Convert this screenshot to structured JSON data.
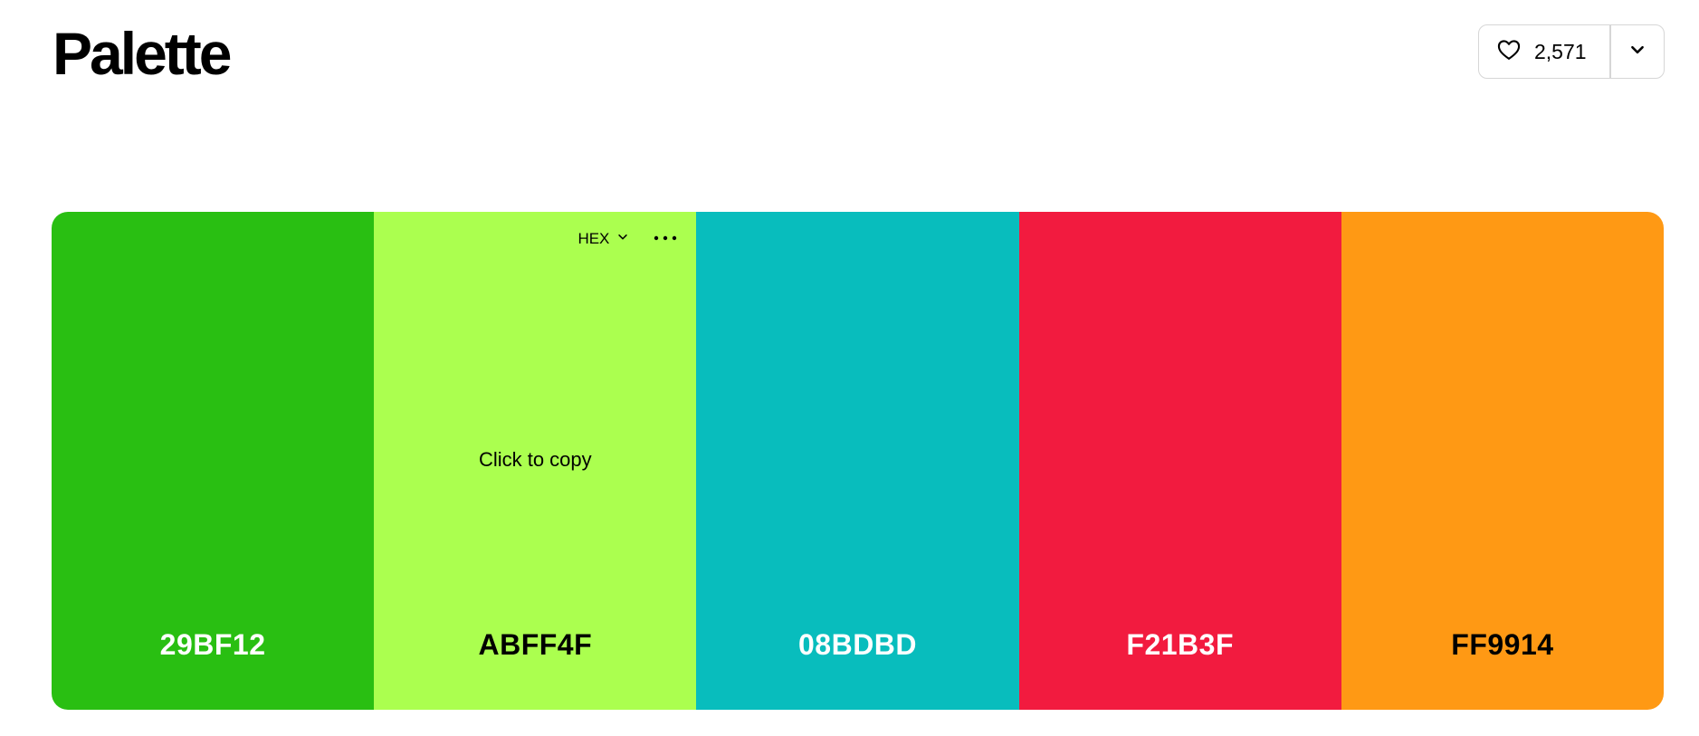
{
  "header": {
    "title": "Palette",
    "like_count": "2,571",
    "like_icon": "heart-icon",
    "menu_icon": "chevron-down-icon"
  },
  "palette": {
    "format_label": "HEX",
    "copy_hint": "Click to copy",
    "swatches": [
      {
        "hex": "29BF12",
        "color": "#29BF12",
        "text_color": "#ffffff"
      },
      {
        "hex": "ABFF4F",
        "color": "#ABFF4F",
        "text_color": "#000000"
      },
      {
        "hex": "08BDBD",
        "color": "#08BDBD",
        "text_color": "#ffffff"
      },
      {
        "hex": "F21B3F",
        "color": "#F21B3F",
        "text_color": "#ffffff"
      },
      {
        "hex": "FF9914",
        "color": "#FF9914",
        "text_color": "#000000"
      }
    ]
  }
}
